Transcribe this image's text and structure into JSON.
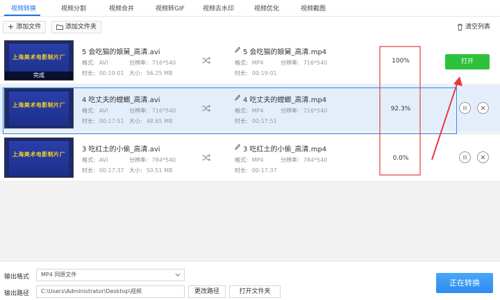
{
  "tabs": [
    "视频转换",
    "视频分割",
    "视频合并",
    "视频转GIF",
    "视频去水印",
    "视频优化",
    "视频截图"
  ],
  "toolbar": {
    "add_file": "添加文件",
    "add_folder": "添加文件夹",
    "clear_list": "清空列表"
  },
  "files": [
    {
      "thumb_text": "上海美术电影制片厂",
      "thumb_caption": "完成",
      "src_name": "5 会吃猫的娘舅_高清.avi",
      "src_format_label": "格式:",
      "src_format": "AVI",
      "src_res_label": "分辨率:",
      "src_res": "716*540",
      "src_dur_label": "时长:",
      "src_dur": "00:19:01",
      "src_size_label": "大小:",
      "src_size": "56.25 MB",
      "out_name": "5 会吃猫的娘舅_高清.mp4",
      "out_format_label": "格式:",
      "out_format": "MP4",
      "out_res_label": "分辨率:",
      "out_res": "716*540",
      "out_dur_label": "时长:",
      "out_dur": "00:19:01",
      "progress": "100%",
      "action": "打开"
    },
    {
      "thumb_text": "上海美术电影制片厂",
      "thumb_caption": "",
      "src_name": "4 吃丈夫的螳螂_高清.avi",
      "src_format_label": "格式:",
      "src_format": "AVI",
      "src_res_label": "分辨率:",
      "src_res": "716*540",
      "src_dur_label": "时长:",
      "src_dur": "00:17:51",
      "src_size_label": "大小:",
      "src_size": "48.65 MB",
      "out_name": "4 吃丈夫的螳螂_高清.mp4",
      "out_format_label": "格式:",
      "out_format": "MP4",
      "out_res_label": "分辨率:",
      "out_res": "716*540",
      "out_dur_label": "时长:",
      "out_dur": "00:17:51",
      "progress": "92.3%"
    },
    {
      "thumb_text": "上海美术电影制片厂",
      "thumb_caption": "",
      "src_name": "3 吃红土的小偷_高清.avi",
      "src_format_label": "格式:",
      "src_format": "AVI",
      "src_res_label": "分辨率:",
      "src_res": "784*540",
      "src_dur_label": "时长:",
      "src_dur": "00:17:37",
      "src_size_label": "大小:",
      "src_size": "50.51 MB",
      "out_name": "3 吃红土的小偷_高清.mp4",
      "out_format_label": "格式:",
      "out_format": "MP4",
      "out_res_label": "分辨率:",
      "out_res": "784*540",
      "out_dur_label": "时长:",
      "out_dur": "00:17:37",
      "progress": "0.0%"
    }
  ],
  "bottom": {
    "format_label": "输出格式",
    "format_value": "MP4  同原文件",
    "path_label": "输出路径",
    "path_value": "C:\\Users\\Administrator\\Desktop\\视频",
    "change_path": "更改路径",
    "open_folder": "打开文件夹",
    "convert": "正在转换"
  },
  "colors": {
    "accent": "#1a73e8",
    "open_button": "#2ec13b",
    "annotation": "#e8383d"
  }
}
